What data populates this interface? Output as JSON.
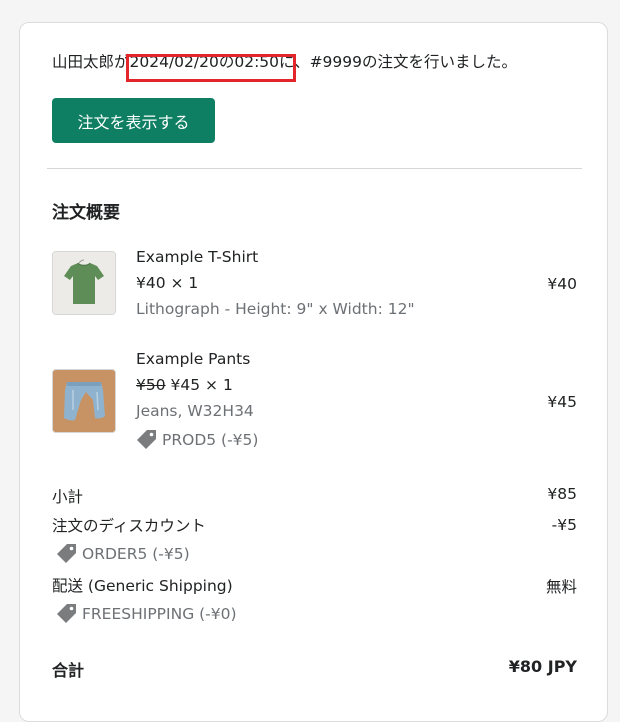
{
  "intro": {
    "before": "山田太郎が",
    "datetime": "2024/02/20の02:50",
    "after": "に、#9999の注文を行いました。"
  },
  "view_order_button": "注文を表示する",
  "summary_title": "注文概要",
  "items": [
    {
      "name": "Example T-Shirt",
      "original_price": "",
      "price_qty": "¥40 × 1",
      "variant": "Lithograph - Height: 9\" x Width: 12\"",
      "discount": "",
      "line_total": "¥40"
    },
    {
      "name": "Example Pants",
      "original_price": "¥50",
      "price_qty": "¥45 × 1",
      "variant": "Jeans, W32H34",
      "discount": "PROD5 (-¥5)",
      "line_total": "¥45"
    }
  ],
  "totals": {
    "subtotal_label": "小計",
    "subtotal_value": "¥85",
    "order_discount_label": "注文のディスカウント",
    "order_discount_value": "-¥5",
    "order_discount_code": "ORDER5 (-¥5)",
    "shipping_label": "配送 (Generic Shipping)",
    "shipping_value": "無料",
    "shipping_code": "FREESHIPPING (-¥0)",
    "total_label": "合計",
    "total_value": "¥80 JPY"
  },
  "colors": {
    "button": "#0e7f63",
    "highlight_box": "#e3262c",
    "muted_text": "#6d7175"
  },
  "icons": [
    "discount-tag-icon",
    "tshirt-image",
    "pants-image"
  ]
}
